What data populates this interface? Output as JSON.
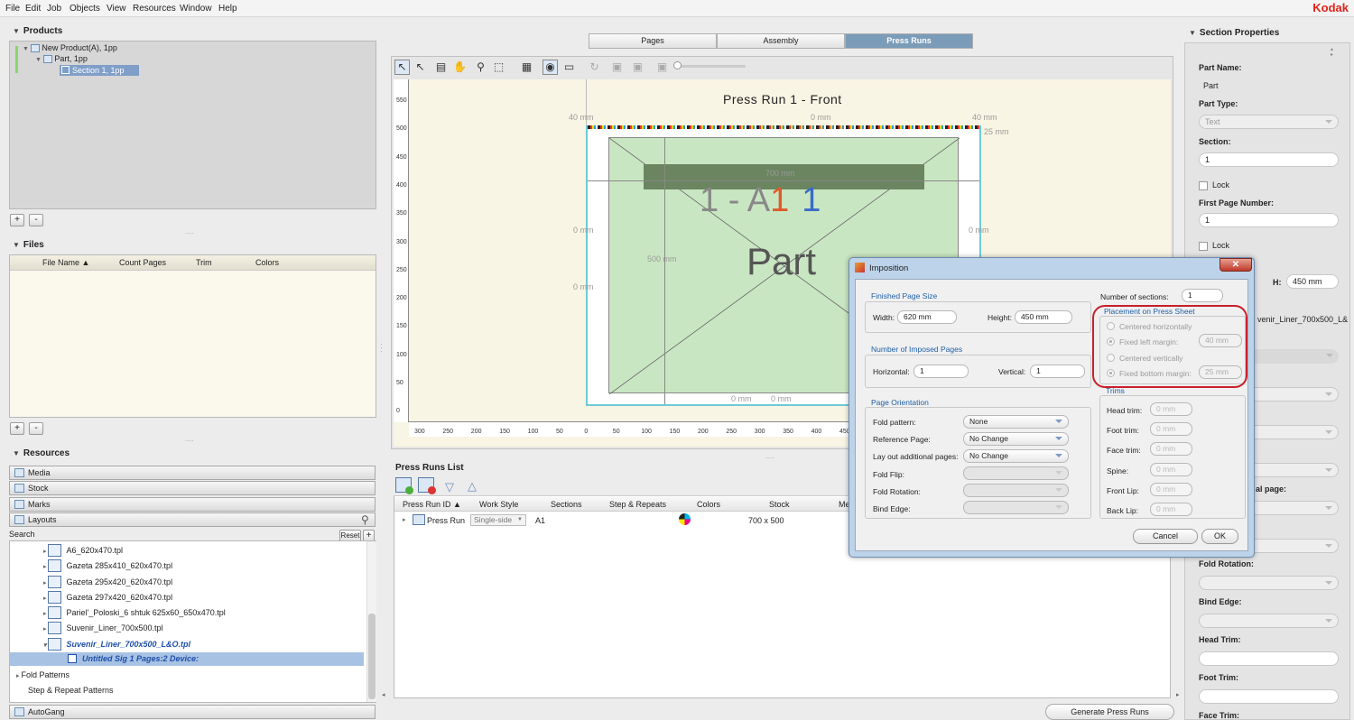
{
  "menu": [
    "File",
    "Edit",
    "Job",
    "Objects",
    "View",
    "Resources",
    "Window",
    "Help"
  ],
  "brand": "Kodak",
  "products": {
    "title": "Products",
    "items": [
      "New Product(A), 1pp",
      "Part, 1pp",
      "Section 1, 1pp"
    ]
  },
  "files": {
    "title": "Files",
    "columns": [
      "File Name",
      "Count Pages",
      "Trim",
      "Colors"
    ]
  },
  "resources": {
    "title": "Resources",
    "sections": [
      "Media",
      "Stock",
      "Marks",
      "Layouts"
    ],
    "search_label": "Search",
    "reset": "Reset",
    "templates": [
      "A6_620x470.tpl",
      "Gazeta 285x410_620x470.tpl",
      "Gazeta 295x420_620x470.tpl",
      "Gazeta 297x420_620x470.tpl",
      "Pariel'_Poloski_6 shtuk 625x60_650x470.tpl",
      "Suvenir_Liner_700x500.tpl",
      "Suvenir_Liner_700x500_L&O.tpl"
    ],
    "selected_sig": "Untitled Sig 1  Pages:2  Device:",
    "fold_patterns": "Fold Patterns",
    "step_repeat": "Step & Repeat Patterns",
    "autogang": "AutoGang"
  },
  "tabs": [
    "Pages",
    "Assembly",
    "Press Runs"
  ],
  "canvas": {
    "title": "Press Run 1 - Front",
    "page_big_label": "1 - A",
    "page_num1": "1",
    "page_num2": "1",
    "part_label": "Part",
    "dims": {
      "top_left": "40 mm",
      "top_mid": "0 mm",
      "top_right": "40 mm",
      "right_top": "25 mm",
      "width": "700 mm",
      "left1": "0 mm",
      "left2": "0 mm",
      "height": "500 mm",
      "right_mid": "0 mm",
      "bottom1": "0 mm",
      "bottom2": "0 mm"
    },
    "ruler_v": [
      "550",
      "500",
      "450",
      "400",
      "350",
      "300",
      "250",
      "200",
      "150",
      "100",
      "50",
      "0"
    ],
    "ruler_h": [
      "300",
      "250",
      "200",
      "150",
      "100",
      "50",
      "0",
      "50",
      "100",
      "150",
      "200",
      "250",
      "300",
      "350",
      "400",
      "450"
    ]
  },
  "press_runs": {
    "title": "Press Runs List",
    "columns": [
      "Press Run ID",
      "Work Style",
      "Sections",
      "Step & Repeats",
      "Colors",
      "Stock",
      "Me"
    ],
    "row": {
      "id": "Press Run",
      "work_style": "Single-side",
      "sections": "A1",
      "stock": "700 x 500"
    },
    "generate": "Generate Press Runs"
  },
  "section_props": {
    "title": "Section Properties",
    "part_name_label": "Part Name:",
    "part_name": "Part",
    "part_type_label": "Part Type:",
    "part_type": "Text",
    "section_label": "Section:",
    "section": "1",
    "lock": "Lock",
    "first_page_label": "First Page Number:",
    "first_page": "1",
    "h_label": "H:",
    "h_value": "450 mm",
    "layout_partial": "venir_Liner_700x500_L&",
    "label_page": "al page:",
    "fold_rotation": "Fold Rotation:",
    "bind_edge": "Bind Edge:",
    "head_trim": "Head Trim:",
    "foot_trim": "Foot Trim:",
    "face_trim": "Face Trim:"
  },
  "dialog": {
    "title": "Imposition",
    "finished_size": "Finished Page Size",
    "width_label": "Width:",
    "width": "620 mm",
    "height_label": "Height:",
    "height": "450 mm",
    "num_imposed": "Number of Imposed Pages",
    "horizontal_label": "Horizontal:",
    "horizontal": "1",
    "vertical_label": "Vertical:",
    "vertical": "1",
    "orientation": "Page Orientation",
    "fold_pattern_label": "Fold pattern:",
    "fold_pattern": "None",
    "ref_page_label": "Reference Page:",
    "ref_page": "No Change",
    "layout_add_label": "Lay out additional pages:",
    "layout_add": "No Change",
    "fold_flip": "Fold Flip:",
    "fold_rotation": "Fold Rotation:",
    "bind_edge": "Bind Edge:",
    "num_sections_label": "Number of sections:",
    "num_sections": "1",
    "placement": "Placement on Press Sheet",
    "centered_h": "Centered horizontally",
    "fixed_left": "Fixed left margin:",
    "fixed_left_val": "40 mm",
    "centered_v": "Centered vertically",
    "fixed_bottom": "Fixed bottom margin:",
    "fixed_bottom_val": "25 mm",
    "trims": "Trims",
    "head_trim": "Head trim:",
    "foot_trim": "Foot trim:",
    "face_trim": "Face trim:",
    "spine": "Spine:",
    "front_lip": "Front Lip:",
    "back_lip": "Back Lip:",
    "zero": "0 mm",
    "cancel": "Cancel",
    "ok": "OK"
  },
  "colors": {
    "accent_tab": "#7a9cb8",
    "highlight_circle": "#c8202a",
    "page_fill": "#c9e6c2",
    "sel_row": "#a8c2e4"
  }
}
